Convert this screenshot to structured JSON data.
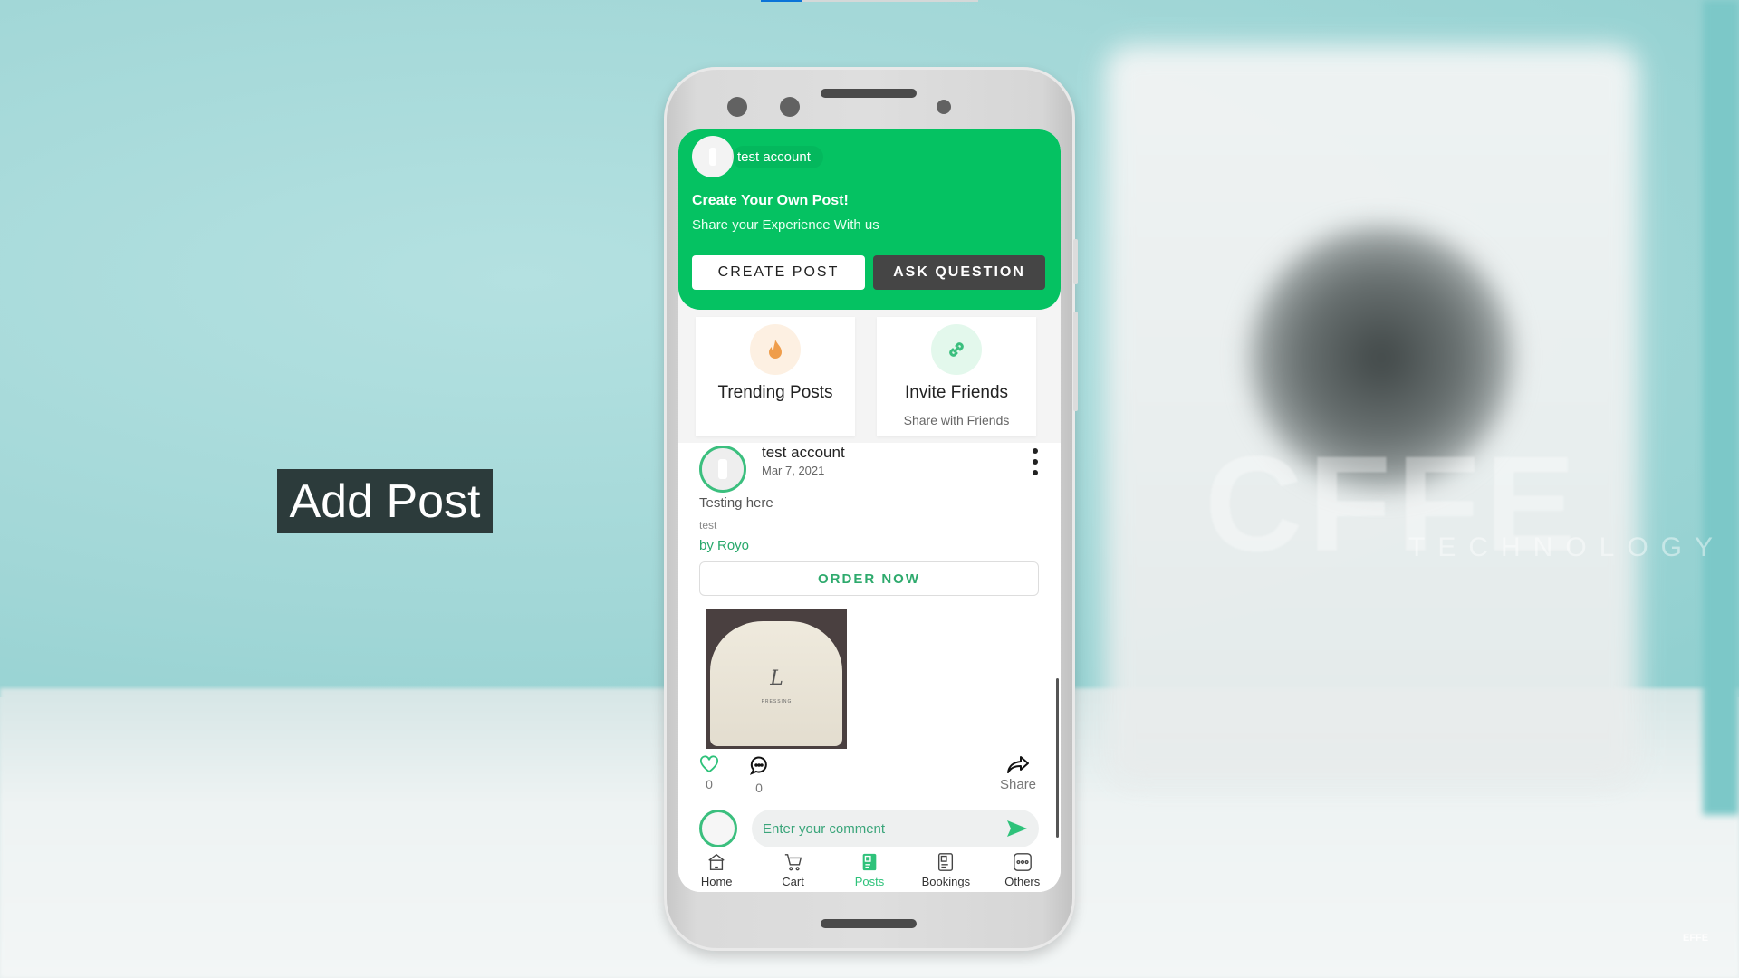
{
  "overlay": {
    "caption": "Add Post",
    "top_progress_fraction": 0.19,
    "watermark": "CFFE",
    "watermark_sub": "TECHNOLOGY",
    "corner_mark": "EFFE"
  },
  "colors": {
    "brand_green": "#05c262",
    "dark_button": "#454545",
    "accent_text_green": "#26a86a"
  },
  "header": {
    "username": "test account",
    "title": "Create Your Own Post!",
    "subtitle": "Share your Experience With us",
    "create_post_label": "CREATE POST",
    "ask_question_label": "ASK QUESTION"
  },
  "cards": [
    {
      "title": "Trending Posts",
      "subtitle": "",
      "icon": "fire-icon"
    },
    {
      "title": "Invite Friends",
      "subtitle": "Share with Friends",
      "icon": "link-icon"
    }
  ],
  "post": {
    "author": "test account",
    "date": "Mar 7, 2021",
    "title": "Testing here",
    "body": "test",
    "by": "by Royo",
    "order_label": "ORDER NOW",
    "image": {
      "logo": "L",
      "brand": "PRESSING"
    },
    "likes": "0",
    "comments": "0",
    "share_label": "Share",
    "comment_placeholder": "Enter your comment"
  },
  "nav": [
    {
      "label": "Home",
      "icon": "home-icon",
      "active": false
    },
    {
      "label": "Cart",
      "icon": "cart-icon",
      "active": false
    },
    {
      "label": "Posts",
      "icon": "posts-icon",
      "active": true
    },
    {
      "label": "Bookings",
      "icon": "bookings-icon",
      "active": false
    },
    {
      "label": "Others",
      "icon": "others-icon",
      "active": false
    }
  ]
}
